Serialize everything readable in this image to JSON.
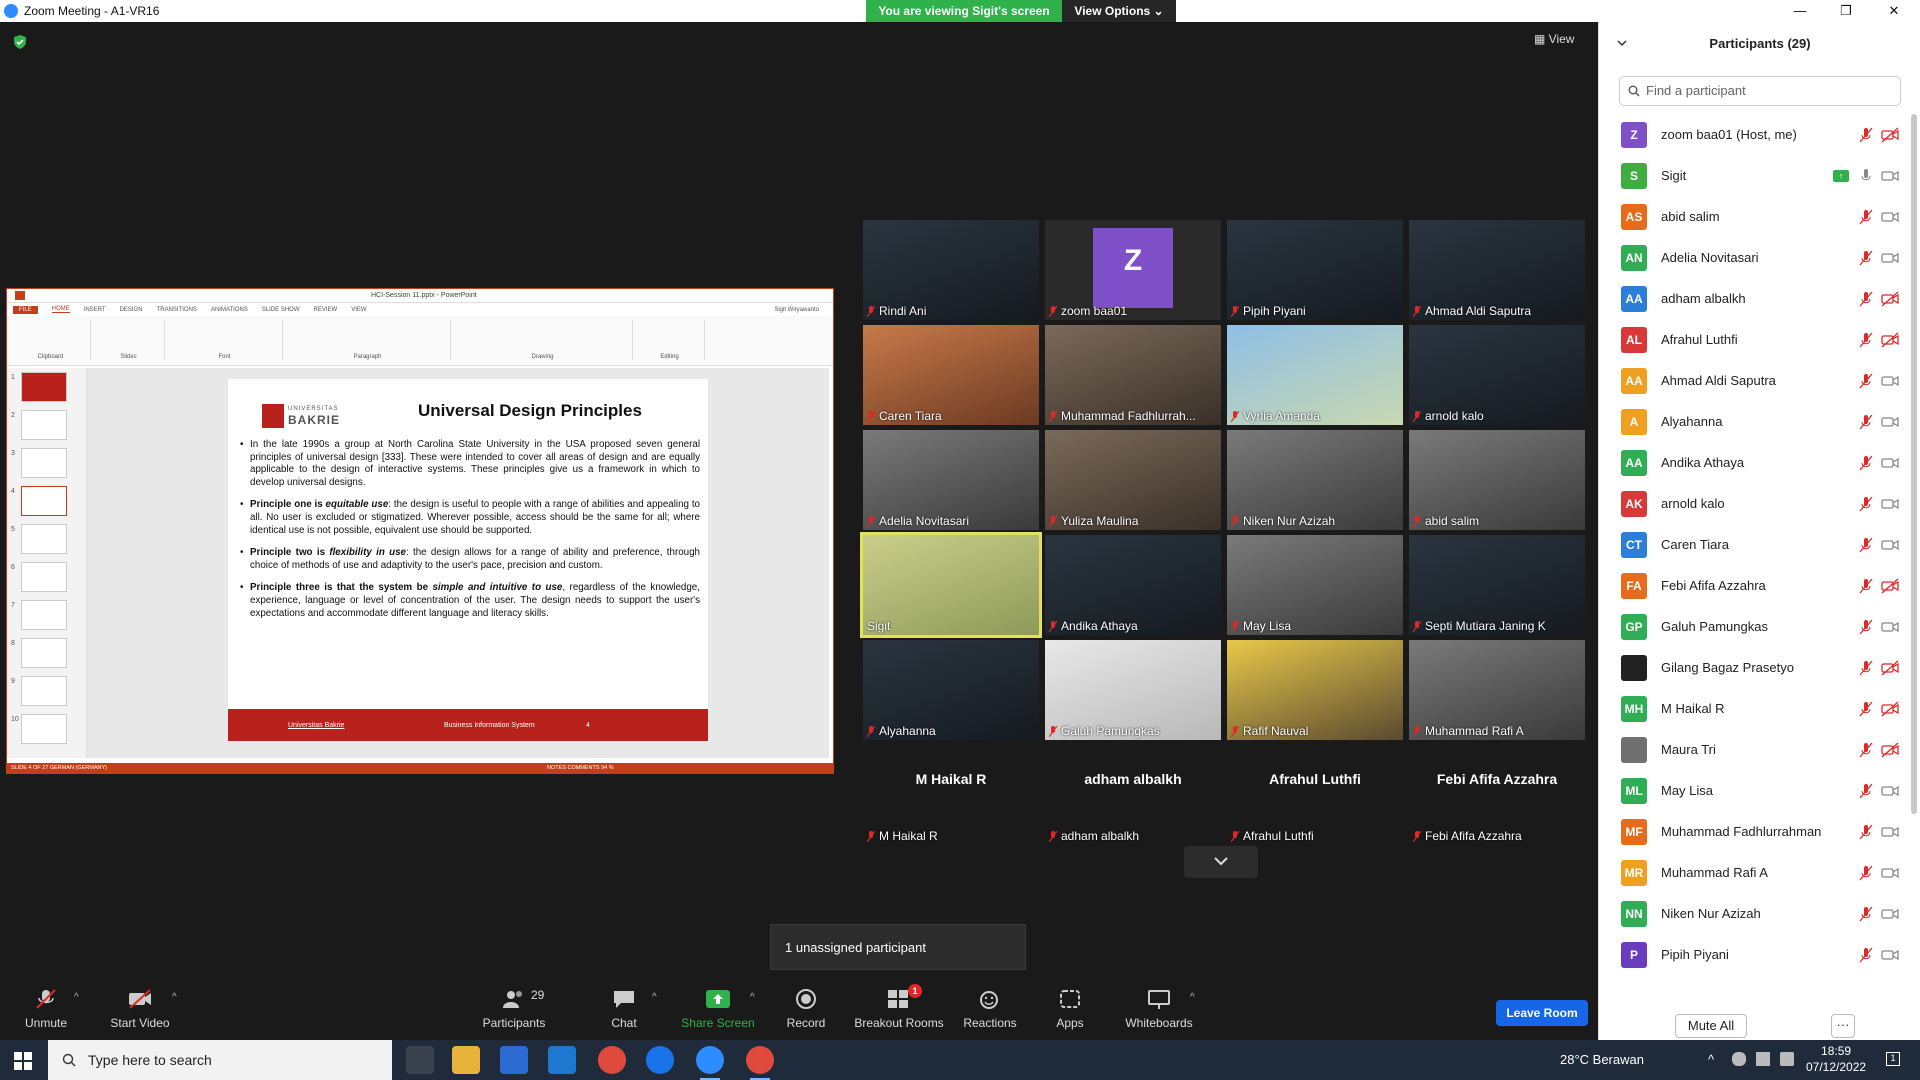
{
  "window": {
    "title": "Zoom Meeting - A1-VR16",
    "minimize": "—",
    "maximize": "❐",
    "close": "✕"
  },
  "banner": {
    "viewing": "You are viewing Sigit's screen",
    "view_options": "View Options"
  },
  "view_button": "View",
  "ppt": {
    "title": "HCI-Session 11.pptx - PowerPoint",
    "user": "Sigit Wiryawanto",
    "tabs": [
      "FILE",
      "HOME",
      "INSERT",
      "DESIGN",
      "TRANSITIONS",
      "ANIMATIONS",
      "SLIDE SHOW",
      "REVIEW",
      "VIEW"
    ],
    "groups": [
      "Clipboard",
      "Slides",
      "Font",
      "Paragraph",
      "Drawing",
      "Editing"
    ],
    "thumb_numbers": [
      "1",
      "2",
      "3",
      "4",
      "5",
      "6",
      "7",
      "8",
      "9",
      "10"
    ],
    "slide": {
      "logo_line1": "UNIVERSITAS",
      "logo_line2": "BAKRIE",
      "title": "Universal Design Principles",
      "bullets": [
        {
          "lead": "",
          "lead_italic": "",
          "text": "In the late 1990s a group at North Carolina State University in the USA proposed  seven general principles of universal design [333]. These were intended to cover all  areas of design and are equally applicable to the design  of interactive systems.  These principles give us a framework in which to develop universal designs."
        },
        {
          "lead": "Principle one is ",
          "lead_italic": "equitable use",
          "text": ": the design is useful to people with a range of abilities  and appealing to all. No user is excluded or stigmatized. Wherever possible, access  should be the same for all; where identical use is not possible, equivalent use  should be supported."
        },
        {
          "lead": "Principle two is ",
          "lead_italic": "flexibility in use",
          "text": ": the design allows for a range of ability and  preference, through choice of methods of use and adaptivity to the user's pace,  precision and custom."
        },
        {
          "lead": "Principle three is that the system be ",
          "lead_italic": "simple and intuitive to use",
          "text": ", regardless of the knowledge, experience, language or level of concentration of the user. The design  needs to support the user's expectations and accommodate different language and  literacy skills."
        }
      ],
      "footer_left": "Universitas Bakrie",
      "footer_center": "Business Information System",
      "footer_page": "4"
    },
    "status": "SLIDE 4 OF 27     GERMAN (GERMANY)",
    "status_right": "NOTES    COMMENTS    94 %"
  },
  "tiles": [
    {
      "name": "Rindi Ani",
      "style": "dark"
    },
    {
      "name": "zoom baa01",
      "style": "avatar",
      "avatar": "Z"
    },
    {
      "name": "Pipih Piyani",
      "style": "dark"
    },
    {
      "name": "Ahmad Aldi Saputra",
      "style": "dark"
    },
    {
      "name": "Caren Tiara",
      "style": "orange"
    },
    {
      "name": "Muhammad Fadhlurrah...",
      "style": "room"
    },
    {
      "name": "Vyrlia Amanda",
      "style": "sky"
    },
    {
      "name": "arnold kalo",
      "style": "dark"
    },
    {
      "name": "Adelia Novitasari",
      "style": "grey"
    },
    {
      "name": "Yuliza Maulina",
      "style": "room"
    },
    {
      "name": "Niken Nur Azizah",
      "style": "grey"
    },
    {
      "name": "abid salim",
      "style": "grey"
    },
    {
      "name": "Sigit",
      "style": "speaker"
    },
    {
      "name": "Andika Athaya",
      "style": "dark"
    },
    {
      "name": "May Lisa",
      "style": "grey"
    },
    {
      "name": "Septi Mutiara Janing K",
      "style": "dark"
    },
    {
      "name": "Alyahanna",
      "style": "dark"
    },
    {
      "name": "Galuh Pamungkas",
      "style": "light"
    },
    {
      "name": "Rafif Nauval",
      "style": "yellow"
    },
    {
      "name": "Muhammad Rafi A",
      "style": "grey"
    },
    {
      "name": "M Haikal R",
      "style": "black",
      "big": "M Haikal R"
    },
    {
      "name": "adham albalkh",
      "style": "black",
      "big": "adham albalkh"
    },
    {
      "name": "Afrahul Luthfi",
      "style": "black",
      "big": "Afrahul Luthfi"
    },
    {
      "name": "Febi Afifa Azzahra",
      "style": "black",
      "big": "Febi Afifa Azzahra"
    }
  ],
  "unassigned": "1 unassigned participant",
  "toolbar": {
    "unmute": "Unmute",
    "start_video": "Start Video",
    "participants": "Participants",
    "participants_count": "29",
    "chat": "Chat",
    "share_screen": "Share Screen",
    "record": "Record",
    "breakout_rooms": "Breakout Rooms",
    "breakout_badge": "1",
    "reactions": "Reactions",
    "apps": "Apps",
    "whiteboards": "Whiteboards",
    "leave_room": "Leave Room"
  },
  "panel": {
    "title": "Participants (29)",
    "search_placeholder": "Find a participant",
    "mute_all": "Mute All",
    "more": "···",
    "participants": [
      {
        "initials": "Z",
        "name": "zoom baa01 (Host, me)",
        "color": "#8050c8",
        "cam": "off"
      },
      {
        "initials": "S",
        "name": "Sigit",
        "color": "#3fae3f",
        "cam": "on",
        "sharing": true,
        "mic": "on"
      },
      {
        "initials": "AS",
        "name": "abid salim",
        "color": "#e86b1c",
        "cam": "on"
      },
      {
        "initials": "AN",
        "name": "Adelia Novitasari",
        "color": "#2fae55",
        "cam": "on"
      },
      {
        "initials": "AA",
        "name": "adham albalkh",
        "color": "#2d7ed8",
        "cam": "off"
      },
      {
        "initials": "AL",
        "name": "Afrahul Luthfi",
        "color": "#d83838",
        "cam": "off"
      },
      {
        "initials": "AA",
        "name": "Ahmad Aldi Saputra",
        "color": "#f0a020",
        "cam": "on"
      },
      {
        "initials": "A",
        "name": "Alyahanna",
        "color": "#f0a020",
        "cam": "on"
      },
      {
        "initials": "AA",
        "name": "Andika Athaya",
        "color": "#2fae55",
        "cam": "on"
      },
      {
        "initials": "AK",
        "name": "arnold kalo",
        "color": "#d83838",
        "cam": "on"
      },
      {
        "initials": "CT",
        "name": "Caren Tiara",
        "color": "#2d7ed8",
        "cam": "on"
      },
      {
        "initials": "FA",
        "name": "Febi Afifa Azzahra",
        "color": "#e86b1c",
        "cam": "off"
      },
      {
        "initials": "GP",
        "name": "Galuh Pamungkas",
        "color": "#2fae55",
        "cam": "on"
      },
      {
        "initials": "",
        "name": "Gilang Bagaz Prasetyo",
        "color": "#222222",
        "cam": "off"
      },
      {
        "initials": "MH",
        "name": "M Haikal R",
        "color": "#2fae55",
        "cam": "off"
      },
      {
        "initials": "",
        "name": "Maura Tri",
        "color": "#707070",
        "cam": "off"
      },
      {
        "initials": "ML",
        "name": "May Lisa",
        "color": "#2fae55",
        "cam": "on"
      },
      {
        "initials": "MF",
        "name": "Muhammad Fadhlurrahman",
        "color": "#e86b1c",
        "cam": "on"
      },
      {
        "initials": "MR",
        "name": "Muhammad Rafi A",
        "color": "#f0a020",
        "cam": "on"
      },
      {
        "initials": "NN",
        "name": "Niken Nur Azizah",
        "color": "#2fae55",
        "cam": "on"
      },
      {
        "initials": "P",
        "name": "Pipih Piyani",
        "color": "#6a3cc0",
        "cam": "on"
      }
    ]
  },
  "taskbar": {
    "search_placeholder": "Type here to search",
    "weather": "28°C  Berawan",
    "time": "18:59",
    "date": "07/12/2022",
    "notif": "1"
  }
}
